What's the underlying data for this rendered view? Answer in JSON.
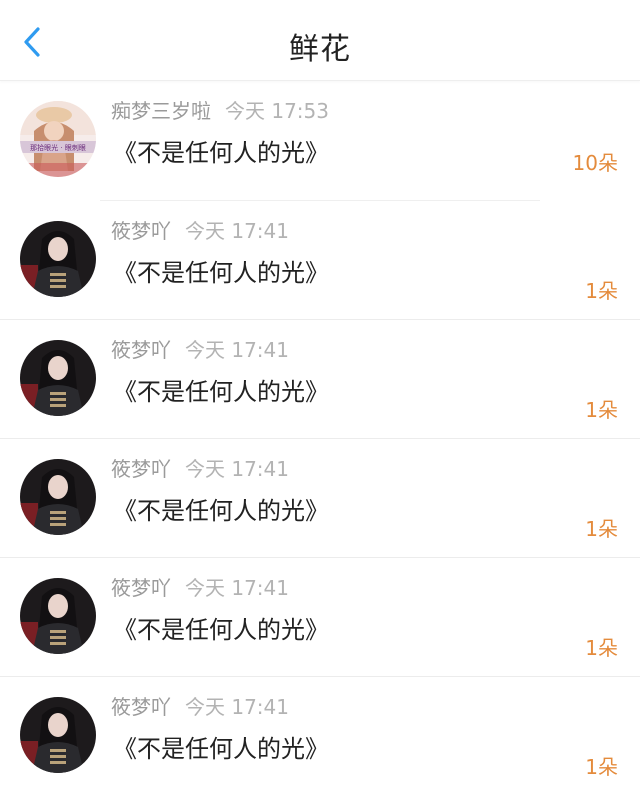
{
  "header": {
    "title": "鲜花",
    "back_icon": "chevron-left-icon",
    "accent_color": "#2f9bf0"
  },
  "colors": {
    "count": "#e48b3c",
    "meta": "#999999",
    "text": "#222222"
  },
  "avatar_overlay_text": "那拾眼光 · 眼刺眼",
  "rows": [
    {
      "name": "痴梦三岁啦",
      "time": "今天 17:53",
      "book": "《不是任何人的光》",
      "count": "10朵"
    },
    {
      "name": "筱梦吖",
      "time": "今天 17:41",
      "book": "《不是任何人的光》",
      "count": "1朵"
    },
    {
      "name": "筱梦吖",
      "time": "今天 17:41",
      "book": "《不是任何人的光》",
      "count": "1朵"
    },
    {
      "name": "筱梦吖",
      "time": "今天 17:41",
      "book": "《不是任何人的光》",
      "count": "1朵"
    },
    {
      "name": "筱梦吖",
      "time": "今天 17:41",
      "book": "《不是任何人的光》",
      "count": "1朵"
    },
    {
      "name": "筱梦吖",
      "time": "今天 17:41",
      "book": "《不是任何人的光》",
      "count": "1朵"
    }
  ]
}
